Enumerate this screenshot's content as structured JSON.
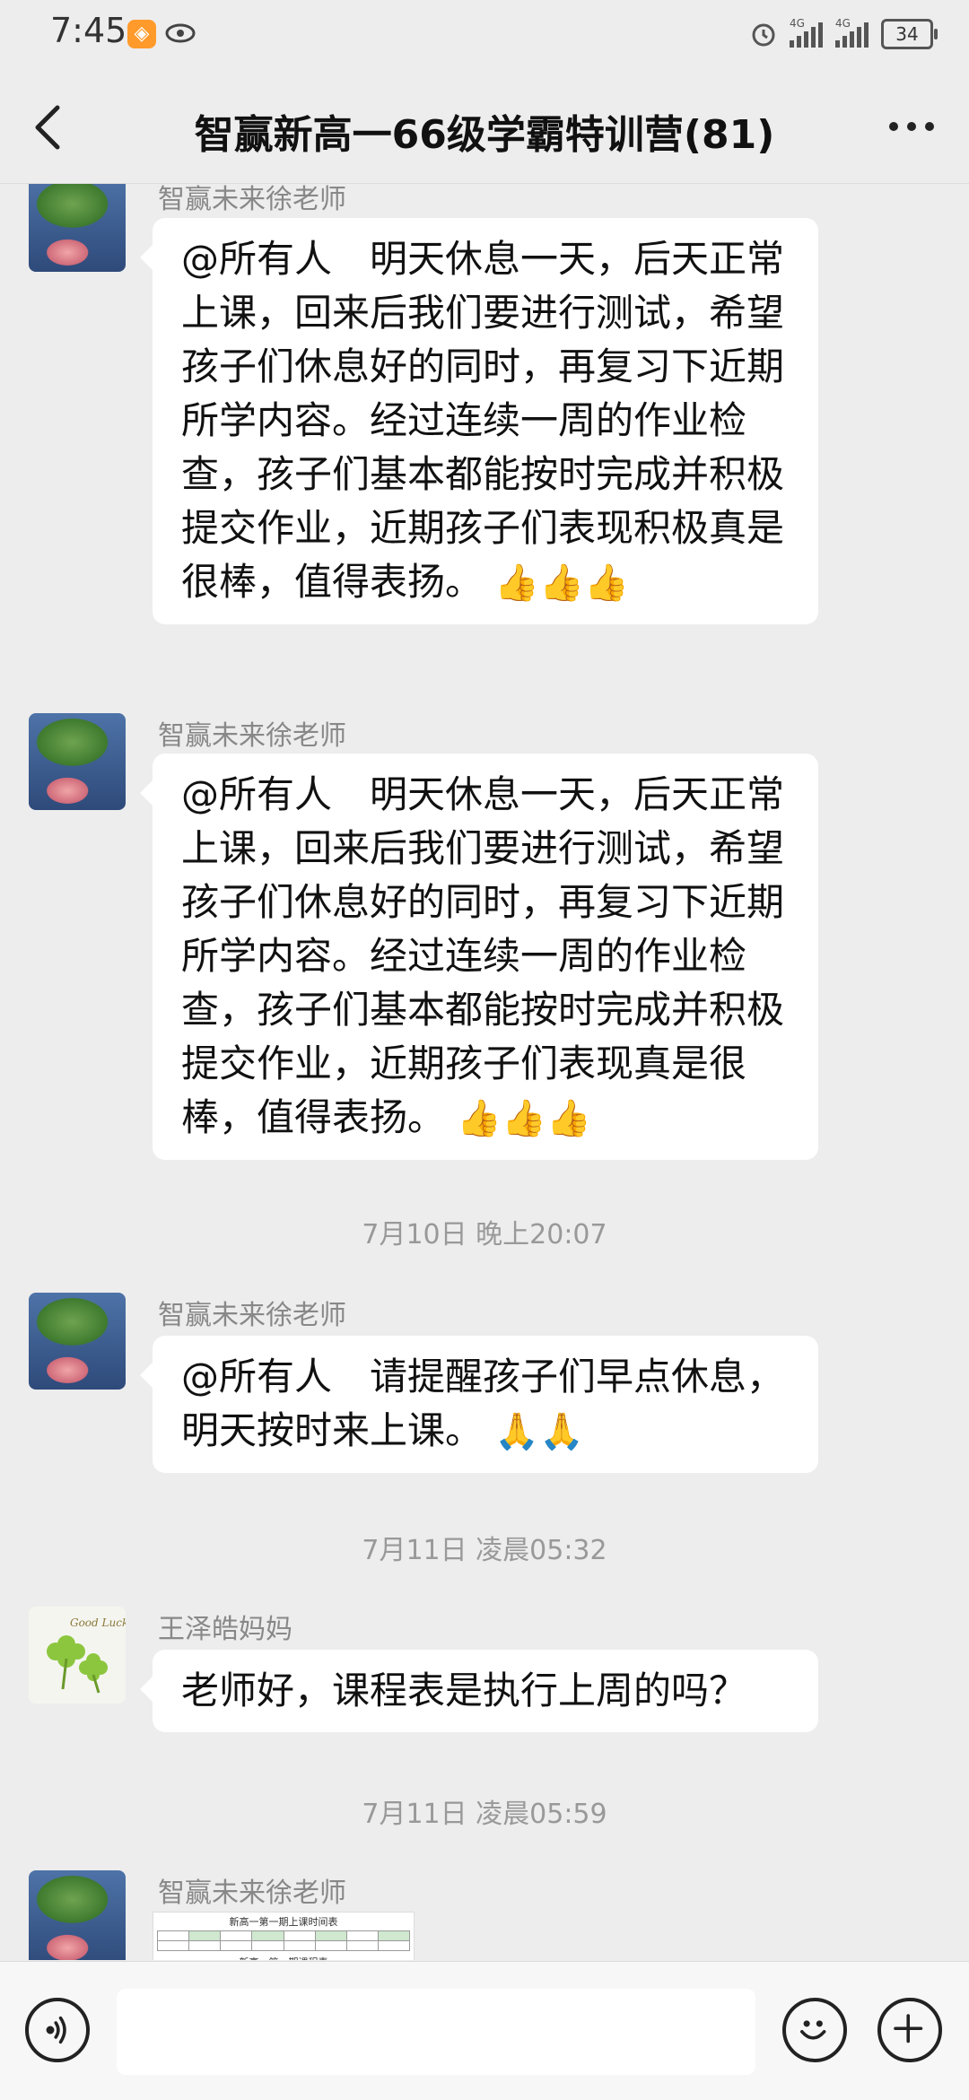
{
  "status_bar": {
    "time": "7:45",
    "signal1_label": "4G",
    "signal2_label": "4G",
    "battery": "34"
  },
  "header": {
    "title": "智赢新高一66级学霸特训营(81)"
  },
  "messages": [
    {
      "sender": "智赢未来徐老师",
      "text": "@所有人　明天休息一天，后天正常上课，回来后我们要进行测试，希望孩子们休息好的同时，再复习下近期所学内容。经过连续一周的作业检查，孩子们基本都能按时完成并积极提交作业，近期孩子们表现积极真是很棒，值得表扬。",
      "emoji": "👍👍👍"
    },
    {
      "sender": "智赢未来徐老师",
      "text": "@所有人　明天休息一天，后天正常上课，回来后我们要进行测试，希望孩子们休息好的同时，再复习下近期所学内容。经过连续一周的作业检查，孩子们基本都能按时完成并积极提交作业，近期孩子们表现真是很棒，值得表扬。",
      "emoji": "👍👍👍"
    },
    {
      "timestamp": "7月10日 晚上20:07"
    },
    {
      "sender": "智赢未来徐老师",
      "text": "@所有人　请提醒孩子们早点休息，明天按时来上课。",
      "emoji": "🙏🙏"
    },
    {
      "timestamp": "7月11日 凌晨05:32"
    },
    {
      "sender": "王泽皓妈妈",
      "avatar_text": "Good Luck",
      "text": "老师好，课程表是执行上周的吗？"
    },
    {
      "timestamp": "7月11日 凌晨05:59"
    },
    {
      "sender": "智赢未来徐老师",
      "image_title": "新高一第一期上课时间表",
      "image_subtitle": "新高一第一期课程表"
    }
  ],
  "icons": {
    "back": "chevron-left-icon",
    "more": "more-dots-icon",
    "voice": "voice-icon",
    "emoji": "emoji-icon",
    "plus": "plus-icon"
  }
}
